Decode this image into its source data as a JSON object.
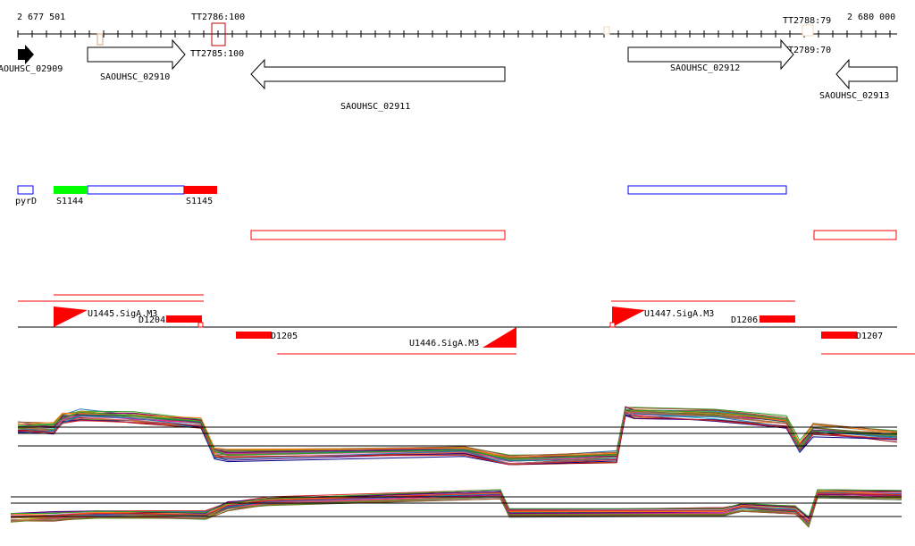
{
  "ruler": {
    "start_label": "2 677 501",
    "end_label": "2 680 000"
  },
  "terminators": {
    "tt2786": "TT2786:100",
    "tt2785": "TT2785:100",
    "tt2788": "TT2788:79",
    "tt2789": "TT2789:70"
  },
  "genes": {
    "g2909": "AOUHSC_02909",
    "g2910": "SAOUHSC_02910",
    "g2911": "SAOUHSC_02911",
    "g2912": "SAOUHSC_02912",
    "g2913": "SAOUHSC_02913"
  },
  "regions": {
    "pyrD": "pyrD",
    "s1144": "S1144",
    "s1145": "S1145"
  },
  "promoters": {
    "u1445": "U1445.SigA.M3",
    "u1446": "U1446.SigA.M3",
    "u1447": "U1447.SigA.M3"
  },
  "segments": {
    "d1204": "D1204",
    "d1205": "D1205",
    "d1206": "D1206",
    "d1207": "D1207"
  },
  "colors": {
    "red": "#ff0000",
    "green": "#00ff00",
    "blue": "#0000ff",
    "tan": "#d9a47a",
    "darkred": "#c00000"
  },
  "expression_profiles": {
    "colors": [
      "#1f77b4",
      "#ff7f0e",
      "#2ca02c",
      "#d62728",
      "#9467bd",
      "#8c564b",
      "#e377c2",
      "#7f7f7f",
      "#bcbd22",
      "#17becf",
      "#8b0000",
      "#556b2f",
      "#000080",
      "#ff1493",
      "#008080",
      "#a0522d",
      "#6b8e23",
      "#4b0082",
      "#cd5c5c",
      "#2f4f4f",
      "#b8860b",
      "#800080"
    ],
    "top": {
      "x": [
        20,
        60,
        70,
        90,
        150,
        225,
        240,
        255,
        520,
        570,
        690,
        700,
        710,
        800,
        880,
        895,
        910,
        1004
      ],
      "level": [
        0.62,
        0.62,
        0.78,
        0.84,
        0.8,
        0.7,
        0.18,
        0.16,
        0.24,
        0.06,
        0.12,
        0.92,
        0.88,
        0.84,
        0.72,
        0.3,
        0.58,
        0.48
      ]
    },
    "bottom": {
      "x": [
        12,
        60,
        110,
        230,
        255,
        300,
        560,
        570,
        810,
        830,
        890,
        905,
        915,
        1009
      ],
      "level": [
        0.28,
        0.32,
        0.38,
        0.34,
        0.58,
        0.7,
        0.9,
        0.42,
        0.44,
        0.56,
        0.48,
        0.18,
        0.9,
        0.86
      ]
    }
  }
}
